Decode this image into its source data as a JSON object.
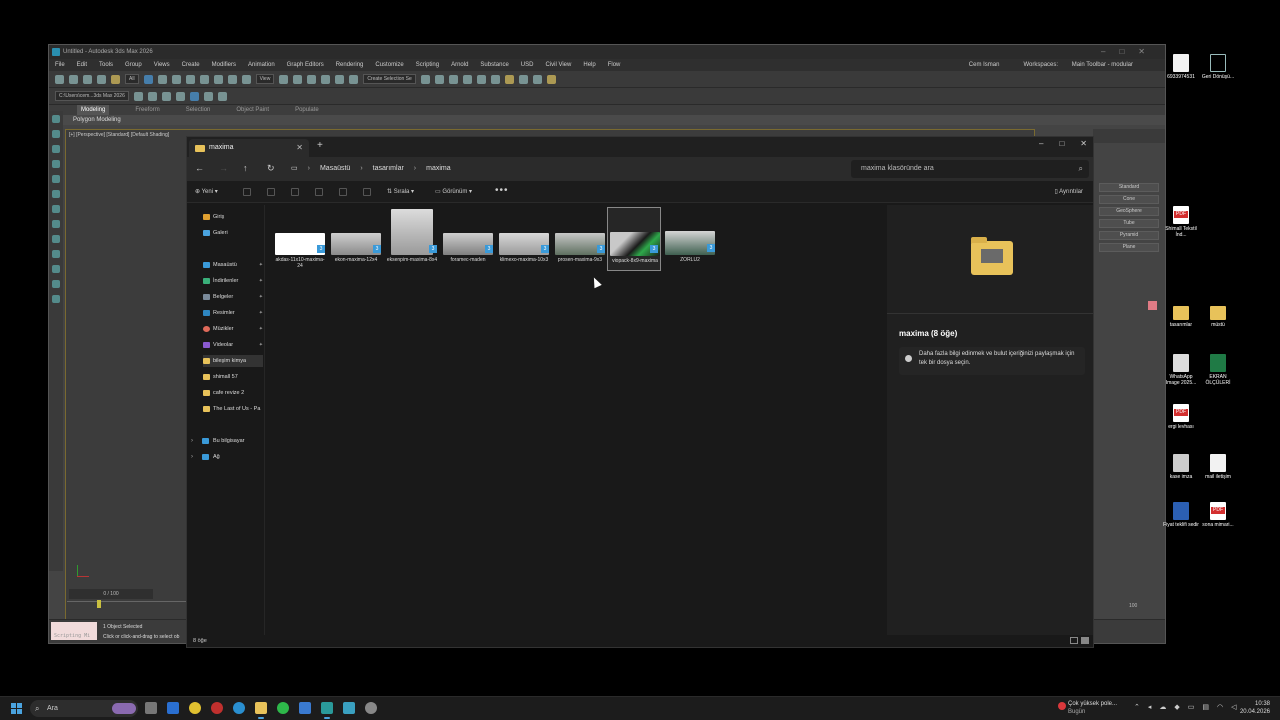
{
  "max": {
    "title": "Untitled - Autodesk 3ds Max 2026",
    "menu": [
      "File",
      "Edit",
      "Tools",
      "Group",
      "Views",
      "Create",
      "Modifiers",
      "Animation",
      "Graph Editors",
      "Rendering",
      "Customize",
      "Scripting",
      "Arnold",
      "Substance",
      "USD",
      "Civil View",
      "Help",
      "Flow"
    ],
    "user": "Cem Isman",
    "workspaces_label": "Workspaces:",
    "workspace": "Main Toolbar - modular",
    "selection_set": "Create Selection Se",
    "filter_all": "All",
    "view_sel": "View",
    "path": "C:\\Users\\cem...3ds Max 2026",
    "ribbon": [
      "Modeling",
      "Freeform",
      "Selection",
      "Object Paint",
      "Populate"
    ],
    "ribbon_active": "Polygon Modeling",
    "viewport_label": "[+] [Perspective] [Standard] [Default Shading]",
    "cmd_buttons": [
      "Cone",
      "GeoSphere",
      "Tube",
      "Pyramid",
      "Plane"
    ],
    "cmd_header": "Standard",
    "timeline": "0 / 100",
    "timeline_end": "100",
    "scripting": "Scripting Mi",
    "status1": "1 Object Selected",
    "status2": "Click or click-and-drag to select ob"
  },
  "explorer": {
    "tab_title": "maxima",
    "path": [
      "Masaüstü",
      "tasarımlar",
      "maxima"
    ],
    "search_placeholder": "maxima klasöründe ara",
    "cmd": {
      "new": "Yeni",
      "sort": "Sırala",
      "view": "Görünüm",
      "details": "Ayrıntılar"
    },
    "nav": {
      "home": "Giriş",
      "gallery": "Galeri",
      "desktop": "Masaüstü",
      "downloads": "İndirilenler",
      "documents": "Belgeler",
      "pictures": "Resimler",
      "music": "Müzikler",
      "videos": "Videolar",
      "f1": "bileşim kimya",
      "f2": "shimall 57",
      "f3": "cafe revize 2",
      "f4": "The Last of Us - Pa",
      "pc": "Bu bilgisayar",
      "network": "Ağ"
    },
    "files": [
      {
        "name": "akdas-11x10-maxima-24"
      },
      {
        "name": "ekon-maxima-12x4"
      },
      {
        "name": "eksenpim-maxima-8x4"
      },
      {
        "name": "foramec-maden"
      },
      {
        "name": "klimexo-maxima-10x3"
      },
      {
        "name": "prosen-maxima-9x3"
      },
      {
        "name": "viopack-8x9-maxima"
      },
      {
        "name": "ZORLU2"
      }
    ],
    "badge": "3",
    "details_title": "maxima (8 öğe)",
    "details_info": "Daha fazla bilgi edinmek ve bulut içeriğinizi paylaşmak için tek bir dosya seçin.",
    "status": "8 öğe"
  },
  "desktop": {
    "icons": [
      {
        "label": "6933974531"
      },
      {
        "label": "Geri Dönüşü..."
      },
      {
        "label": "Shimall Tekstil İnd..."
      },
      {
        "label": "tasarımlar"
      },
      {
        "label": "müstü"
      },
      {
        "label": "WhatsApp Image 2025..."
      },
      {
        "label": "EKRAN ÖLÇÜLERİ"
      },
      {
        "label": "ergi levhası"
      },
      {
        "label": "kase imza"
      },
      {
        "label": "mail iletişim"
      },
      {
        "label": "Fiyat teklifi sedir"
      },
      {
        "label": "sona mimari..."
      }
    ]
  },
  "taskbar": {
    "search": "Ara",
    "notification_title": "Çok yüksek pole...",
    "notification_sub": "Bugün",
    "time": "10:38",
    "date": "20.04.2026"
  }
}
